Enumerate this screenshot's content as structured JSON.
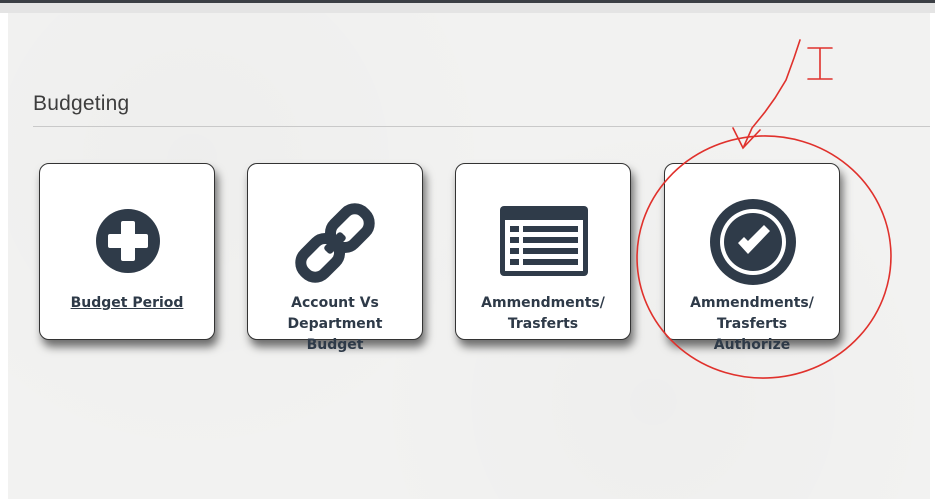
{
  "section": {
    "title": "Budgeting"
  },
  "tiles": [
    {
      "label": "Budget Period",
      "icon": "plus-circle-icon"
    },
    {
      "label_lines": [
        "Account Vs",
        "Department",
        "Budget"
      ],
      "icon": "chain-link-icon"
    },
    {
      "label_lines": [
        "Ammendments/",
        "Trasferts"
      ],
      "icon": "list-document-icon"
    },
    {
      "label_lines": [
        "Ammendments/",
        "Trasferts",
        "Authorize"
      ],
      "icon": "check-circle-icon"
    }
  ],
  "colors": {
    "icon": "#2f3b49",
    "annotation": "#e0312c",
    "panel": "#f2f2f1"
  },
  "annotation": {
    "glyph": "I"
  }
}
